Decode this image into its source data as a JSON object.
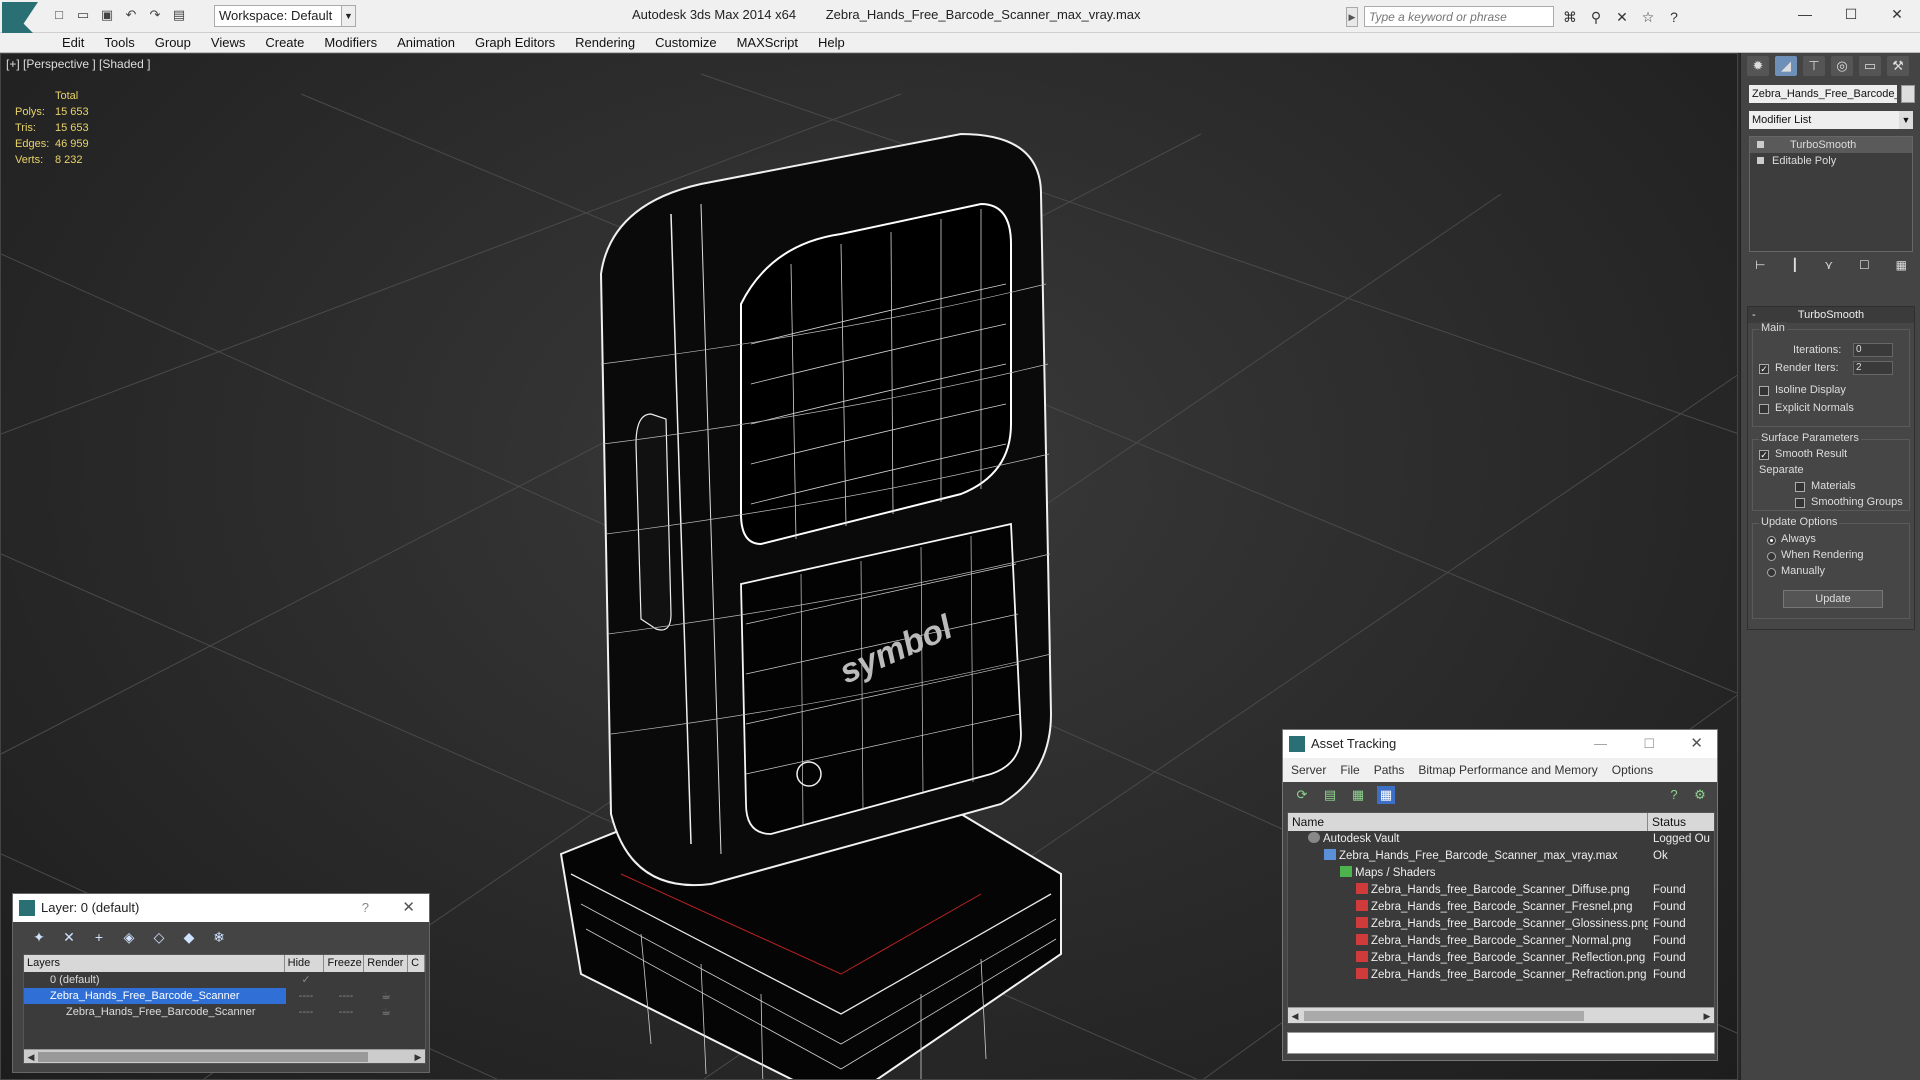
{
  "titlebar": {
    "app_name": "Autodesk 3ds Max  2014 x64",
    "file_name": "Zebra_Hands_Free_Barcode_Scanner_max_vray.max",
    "workspace": "Workspace: Default",
    "search_placeholder": "Type a keyword or phrase"
  },
  "menu": [
    "Edit",
    "Tools",
    "Group",
    "Views",
    "Create",
    "Modifiers",
    "Animation",
    "Graph Editors",
    "Rendering",
    "Customize",
    "MAXScript",
    "Help"
  ],
  "viewport": {
    "label": "[+] [Perspective ] [Shaded ]",
    "stats": {
      "header": "Total",
      "rows": [
        {
          "k": "Polys:",
          "v": "15 653"
        },
        {
          "k": "Tris:",
          "v": "15 653"
        },
        {
          "k": "Edges:",
          "v": "46 959"
        },
        {
          "k": "Verts:",
          "v": "8 232"
        }
      ]
    },
    "logo_text": "symbol"
  },
  "layer_dialog": {
    "title": "Layer: 0 (default)",
    "help": "?",
    "columns": [
      "Layers",
      "Hide",
      "Freeze",
      "Render",
      "C"
    ],
    "rows": [
      {
        "name": "0 (default)",
        "hide": "",
        "freeze": "",
        "render": "",
        "selected": false
      },
      {
        "name": "Zebra_Hands_Free_Barcode_Scanner",
        "hide": "----",
        "freeze": "----",
        "render": "",
        "selected": true
      },
      {
        "name": "Zebra_Hands_Free_Barcode_Scanner",
        "hide": "----",
        "freeze": "----",
        "render": "",
        "selected": false
      }
    ]
  },
  "asset_tracking": {
    "title": "Asset Tracking",
    "menu": [
      "Server",
      "File",
      "Paths",
      "Bitmap Performance and Memory",
      "Options"
    ],
    "columns": {
      "name": "Name",
      "status": "Status"
    },
    "rows": [
      {
        "name": "Autodesk Vault",
        "status": "Logged Ou",
        "icon": "vault",
        "indent": 0
      },
      {
        "name": "Zebra_Hands_Free_Barcode_Scanner_max_vray.max",
        "status": "Ok",
        "icon": "max",
        "indent": 1
      },
      {
        "name": "Maps / Shaders",
        "status": "",
        "icon": "folder",
        "indent": 2
      },
      {
        "name": "Zebra_Hands_free_Barcode_Scanner_Diffuse.png",
        "status": "Found",
        "icon": "png",
        "indent": 3
      },
      {
        "name": "Zebra_Hands_free_Barcode_Scanner_Fresnel.png",
        "status": "Found",
        "icon": "png",
        "indent": 3
      },
      {
        "name": "Zebra_Hands_free_Barcode_Scanner_Glossiness.png",
        "status": "Found",
        "icon": "png",
        "indent": 3
      },
      {
        "name": "Zebra_Hands_free_Barcode_Scanner_Normal.png",
        "status": "Found",
        "icon": "png",
        "indent": 3
      },
      {
        "name": "Zebra_Hands_free_Barcode_Scanner_Reflection.png",
        "status": "Found",
        "icon": "png",
        "indent": 3
      },
      {
        "name": "Zebra_Hands_free_Barcode_Scanner_Refraction.png",
        "status": "Found",
        "icon": "png",
        "indent": 3
      }
    ]
  },
  "command_panel": {
    "object_name": "Zebra_Hands_Free_Barcode_",
    "modifier_list": "Modifier List",
    "stack": [
      "TurboSmooth",
      "Editable Poly"
    ],
    "rollout_title": "TurboSmooth",
    "main_group": "Main",
    "iterations_label": "Iterations:",
    "iterations_value": "0",
    "render_iters_label": "Render Iters:",
    "render_iters_value": "2",
    "isoline_label": "Isoline Display",
    "explicit_normals_label": "Explicit Normals",
    "surface_group": "Surface Parameters",
    "smooth_result_label": "Smooth Result",
    "separate_label": "Separate",
    "materials_label": "Materials",
    "smoothing_groups_label": "Smoothing Groups",
    "update_group": "Update Options",
    "always_label": "Always",
    "when_rendering_label": "When Rendering",
    "manually_label": "Manually",
    "update_button": "Update"
  }
}
